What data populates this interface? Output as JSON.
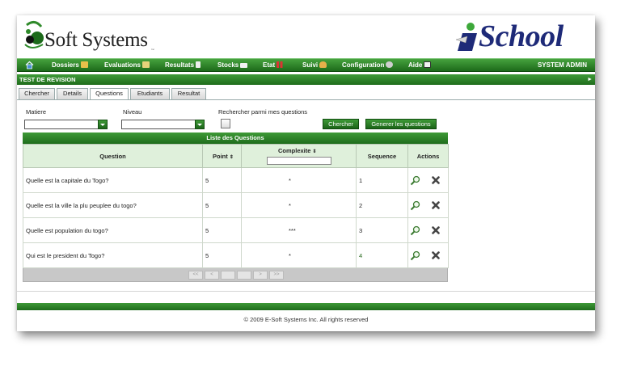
{
  "header": {
    "brand_left": "Soft Systems",
    "brand_left_sub": "Inc",
    "brand_right": "School"
  },
  "nav": {
    "items": [
      {
        "label": "Dossiers",
        "icon": "folder-icon"
      },
      {
        "label": "Evaluations",
        "icon": "pencil-icon"
      },
      {
        "label": "Resultats",
        "icon": "document-icon"
      },
      {
        "label": "Stocks",
        "icon": "box-icon"
      },
      {
        "label": "Etat",
        "icon": "bar-chart-icon"
      },
      {
        "label": "Suivi",
        "icon": "user-icon"
      },
      {
        "label": "Configuration",
        "icon": "gear-icon"
      },
      {
        "label": "Aide",
        "icon": "help-icon"
      }
    ],
    "user": "SYSTEM ADMIN"
  },
  "section": {
    "title": "TEST DE REVISION",
    "arrow": "►"
  },
  "tabs": [
    "Chercher",
    "Details",
    "Questions",
    "Etudiants",
    "Resultat"
  ],
  "active_tab": "Questions",
  "filters": {
    "matiere_label": "Matiere",
    "niveau_label": "Niveau",
    "search_mine_label": "Rechercher parmi mes questions",
    "search_button": "Chercher",
    "generate_button": "Generer les questions"
  },
  "grid": {
    "title": "Liste des Questions",
    "columns": {
      "question": "Question",
      "point": "Point",
      "complexite": "Complexite",
      "sequence": "Sequence",
      "actions": "Actions"
    },
    "sort_glyph": "⇕",
    "rows": [
      {
        "question": "Quelle est la capitale du Togo?",
        "point": "5",
        "complexite": "*",
        "sequence": "1"
      },
      {
        "question": "Quelle est la ville la plu peuplee du togo?",
        "point": "5",
        "complexite": "*",
        "sequence": "2"
      },
      {
        "question": "Quelle est population du togo?",
        "point": "5",
        "complexite": "***",
        "sequence": "3"
      },
      {
        "question": "Qui est le president du Togo?",
        "point": "5",
        "complexite": "*",
        "sequence": "4"
      }
    ],
    "pager": [
      "<<",
      "<",
      "",
      "",
      ">",
      ">>"
    ]
  },
  "footer": {
    "copyright": "© 2009 E-Soft Systems Inc. All rights reserved"
  },
  "colors": {
    "green": "#2e8a2a",
    "dark_green": "#1d6a1a",
    "navy": "#1e2a78"
  }
}
